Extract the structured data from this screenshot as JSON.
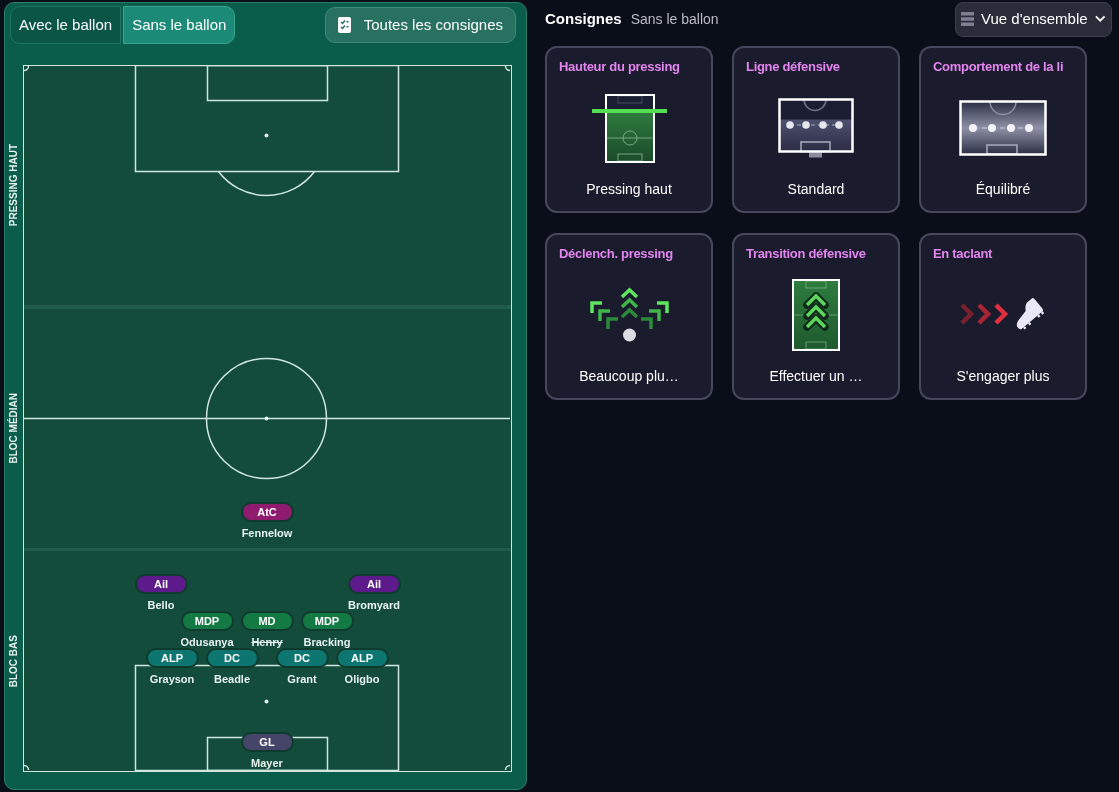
{
  "tabs": [
    {
      "label": "Avec le ballon",
      "selected": false
    },
    {
      "label": "Sans le ballon",
      "selected": true
    }
  ],
  "all_instructions_button": {
    "label": "Toutes les consignes"
  },
  "pitch": {
    "zones": [
      "PRESSING HAUT",
      "BLOC MÉDIAN",
      "BLOC BAS"
    ],
    "players": [
      {
        "role": "AtC",
        "name": "Fennelow",
        "color": "#8e1b6e",
        "crossed_out": false
      },
      {
        "role": "Ail",
        "name": "Bello",
        "color": "#5c1a8a",
        "crossed_out": false
      },
      {
        "role": "Ail",
        "name": "Bromyard",
        "color": "#5c1a8a",
        "crossed_out": false
      },
      {
        "role": "MDP",
        "name": "Odusanya",
        "color": "#137a44",
        "crossed_out": false
      },
      {
        "role": "MD",
        "name": "Henry",
        "color": "#137a44",
        "crossed_out": true
      },
      {
        "role": "MDP",
        "name": "Bracking",
        "color": "#137a44",
        "crossed_out": false
      },
      {
        "role": "ALP",
        "name": "Grayson",
        "color": "#0d7670",
        "crossed_out": false
      },
      {
        "role": "DC",
        "name": "Beadle",
        "color": "#0d7670",
        "crossed_out": false
      },
      {
        "role": "DC",
        "name": "Grant",
        "color": "#0d7670",
        "crossed_out": false
      },
      {
        "role": "ALP",
        "name": "Oligbo",
        "color": "#0d7670",
        "crossed_out": false
      },
      {
        "role": "GL",
        "name": "Mayer",
        "color": "#45456a",
        "crossed_out": false
      }
    ]
  },
  "header": {
    "title": "Consignes",
    "subtitle": "Sans le ballon"
  },
  "view_dropdown": {
    "label": "Vue d'ensemble"
  },
  "cards": [
    {
      "kind": "pressing_height",
      "title": "Hauteur du pressing",
      "value": "Pressing haut"
    },
    {
      "kind": "defensive_line",
      "title": "Ligne défensive",
      "value": "Standard"
    },
    {
      "kind": "line_behavior",
      "title": "Comportement de la li",
      "value": "Équilibré"
    },
    {
      "kind": "press_trigger",
      "title": "Déclench. pressing",
      "value": "Beaucoup plu…"
    },
    {
      "kind": "transition",
      "title": "Transition défensive",
      "value": "Effectuer un …"
    },
    {
      "kind": "tackling",
      "title": "En taclant",
      "value": "S'engager plus"
    }
  ]
}
